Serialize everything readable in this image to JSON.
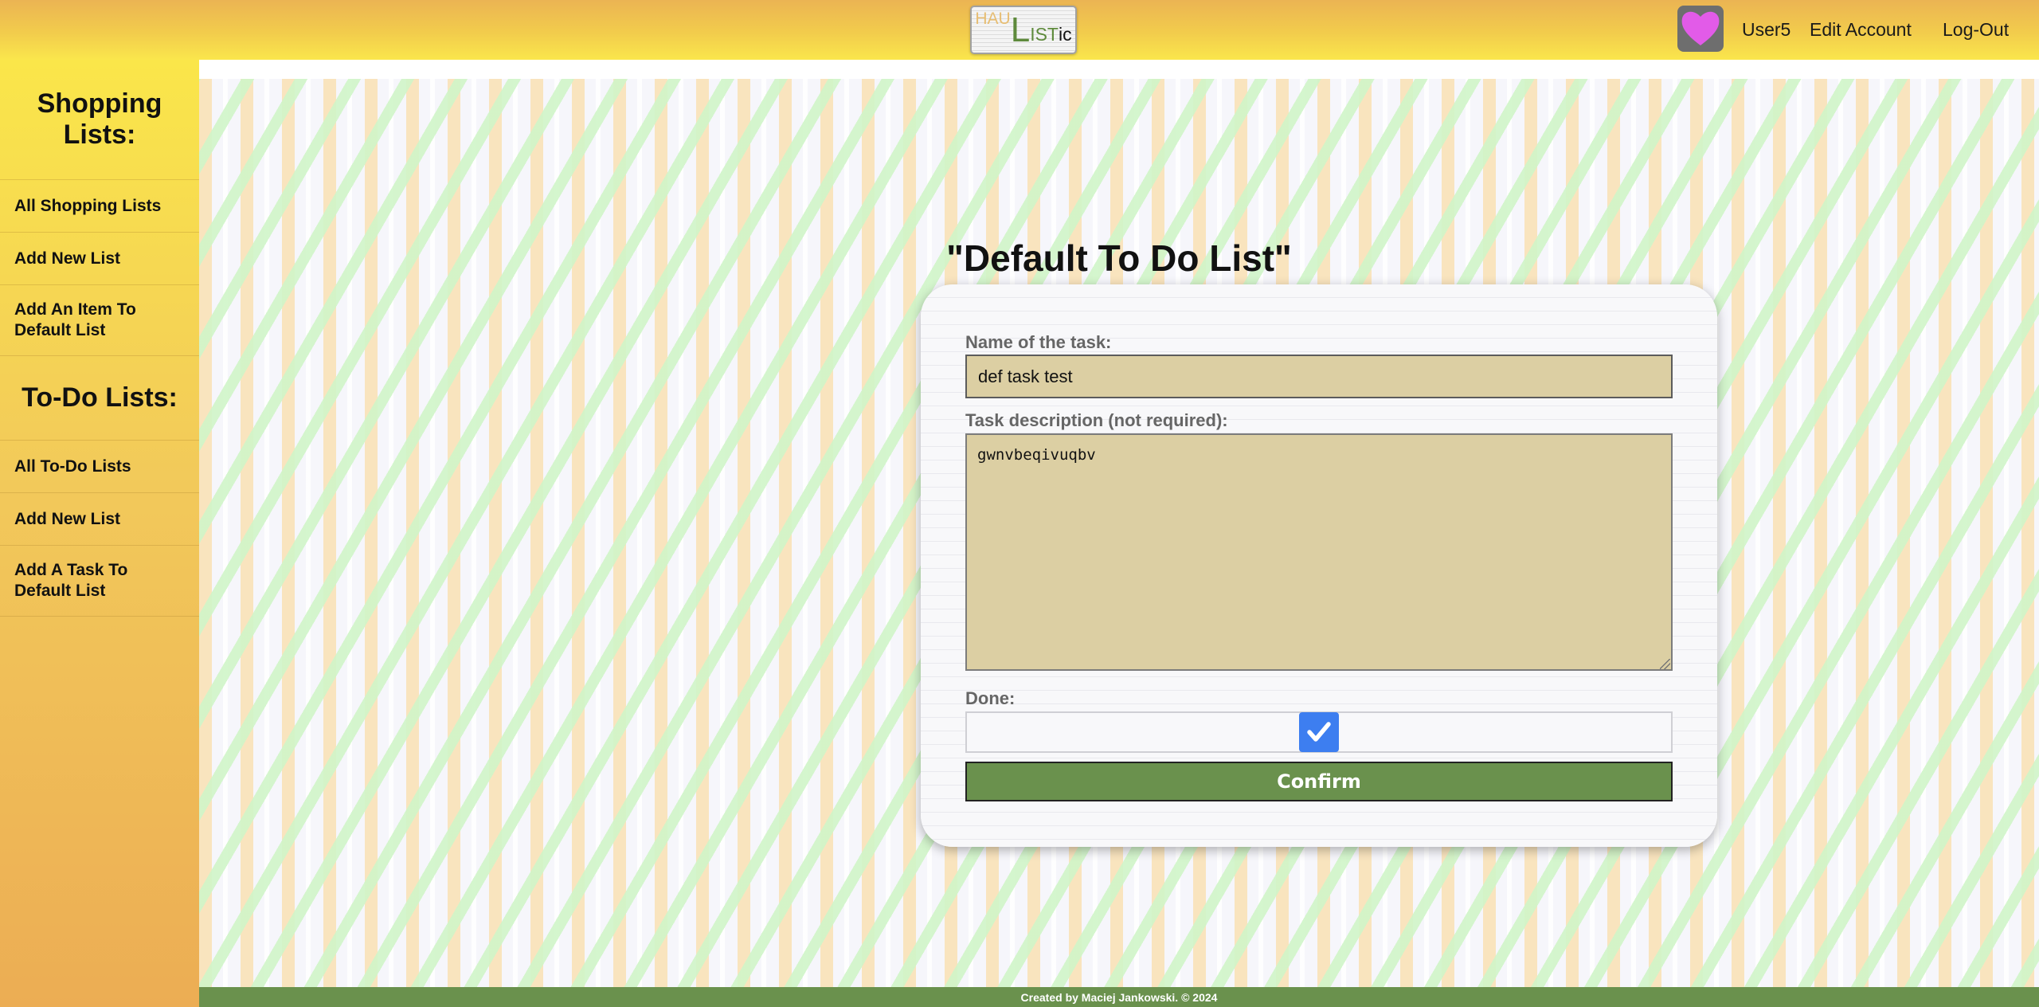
{
  "header": {
    "logo": {
      "part1": "HAU",
      "part2": "L",
      "part3": "IST",
      "part4": "ic"
    },
    "avatar_icon": "heart-icon",
    "avatar_color": "#e25be8",
    "username": "User5",
    "edit_account": "Edit Account",
    "logout": "Log-Out"
  },
  "sidebar": {
    "shopping_heading": "Shopping Lists:",
    "shopping_items": [
      {
        "label": "All Shopping Lists"
      },
      {
        "label": "Add New List"
      },
      {
        "label": "Add An Item To Default List"
      }
    ],
    "todo_heading": "To-Do Lists:",
    "todo_items": [
      {
        "label": "All To-Do Lists"
      },
      {
        "label": "Add New List"
      },
      {
        "label": "Add A Task To Default List"
      }
    ]
  },
  "main": {
    "title": "\"Default To Do List\"",
    "form": {
      "name_label": "Name of the task:",
      "name_value": "def task test",
      "desc_label": "Task description (not required):",
      "desc_value": "gwnvbeqivuqbv",
      "done_label": "Done:",
      "done_checked": true,
      "confirm_label": "Confirm"
    }
  },
  "footer": {
    "text": "Created by Maciej Jankowski. © 2024"
  },
  "colors": {
    "accent_green": "#6a914d",
    "input_bg": "#dccfa3",
    "checkbox_blue": "#3d7ef0",
    "header_yellow": "#f2cc4c"
  }
}
